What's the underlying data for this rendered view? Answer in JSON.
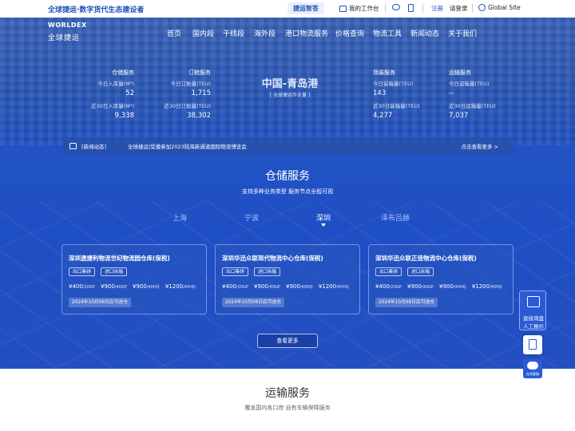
{
  "topbar": {
    "slogan": "全球捷运·数字货代生态建设者",
    "zhida_logo": "捷运智答",
    "workbench": "我的工作台",
    "register": "注册",
    "login": "请登录",
    "global_site": "Global Site"
  },
  "logo": {
    "mark": "WORLDEX",
    "cn": "全球捷运"
  },
  "nav": [
    "首页",
    "国内段",
    "干线段",
    "海外段",
    "港口物流服务",
    "价格查询",
    "物流工具",
    "新闻动态",
    "关于我们"
  ],
  "stats": {
    "warehouse": {
      "title": "仓储服务",
      "today_label": "今日入库量(M³)",
      "today_value": "52",
      "month_label": "近30日入库量(M³)",
      "month_value": "9,338"
    },
    "orders": {
      "title": "订舱服务",
      "today_label": "今日订舱量(TEU)",
      "today_value": "1,715",
      "month_label": "近30日订舱量(TEU)",
      "month_value": "38,302"
    },
    "yard": {
      "title": "场装服务",
      "today_label": "今日装箱量(TEU)",
      "today_value": "143",
      "month_label": "近30日装箱量(TEU)",
      "month_value": "4,277"
    },
    "transport": {
      "title": "运输服务",
      "today_label": "今日运箱量(TEU)",
      "today_value": "--",
      "month_label": "近30日运箱量(TEU)",
      "month_value": "7,037"
    }
  },
  "port": {
    "title": "中国-青岛港",
    "subtitle": "[ 全球捷运作业量 ]"
  },
  "news": {
    "tag": "[新闻动态]",
    "text": "全球捷运|受邀参加2023陆海新通道国际物流博览会",
    "more": "点击查看更多 >"
  },
  "warehouse_section": {
    "title": "仓储服务",
    "subtitle": "支持多种业务类型 服务节点全程可视",
    "cities": [
      "上海",
      "宁波",
      "深圳",
      "泽布吕赫"
    ],
    "active_city": "深圳",
    "cards": [
      {
        "title": "深圳遗捷利物流世纪物流园仓库(保税)",
        "tags": [
          "出口集拼",
          "进口拆箱"
        ],
        "prices": [
          {
            "p": "¥400",
            "u": "/20GP"
          },
          {
            "p": "¥900",
            "u": "/40GP"
          },
          {
            "p": "¥900",
            "u": "/40HQ"
          },
          {
            "p": "¥1200",
            "u": "/45HQ"
          }
        ],
        "date": "2024年10月08日后可进仓"
      },
      {
        "title": "深圳华迅众联现代物流中心仓库(保税)",
        "tags": [
          "出口集拼",
          "进口拆箱"
        ],
        "prices": [
          {
            "p": "¥400",
            "u": "/20GP"
          },
          {
            "p": "¥900",
            "u": "/40GP"
          },
          {
            "p": "¥900",
            "u": "/40HQ"
          },
          {
            "p": "¥1200",
            "u": "/45HQ"
          }
        ],
        "date": "2024年10月08日后可进仓"
      },
      {
        "title": "深圳华迅众联正佳物流中心仓库(保税)",
        "tags": [
          "出口集拼",
          "进口拆箱"
        ],
        "prices": [
          {
            "p": "¥400",
            "u": "/20GP"
          },
          {
            "p": "¥900",
            "u": "/40GP"
          },
          {
            "p": "¥900",
            "u": "/40HQ"
          },
          {
            "p": "¥1200",
            "u": "/45HQ"
          }
        ],
        "date": "2024年10月08日后可进仓"
      }
    ],
    "more_button": "查看更多"
  },
  "transport_section": {
    "title": "运输服务",
    "subtitle": "覆盖国内各口岸 自有车辆保障服务"
  },
  "side": {
    "quote_line1": "直接询盘",
    "quote_line2": "人工报价",
    "chat_label": "在线客服"
  },
  "colors": {
    "brand_blue": "#2450b8",
    "hero_blue": "#2253c4",
    "accent": "#2a5ad6"
  }
}
